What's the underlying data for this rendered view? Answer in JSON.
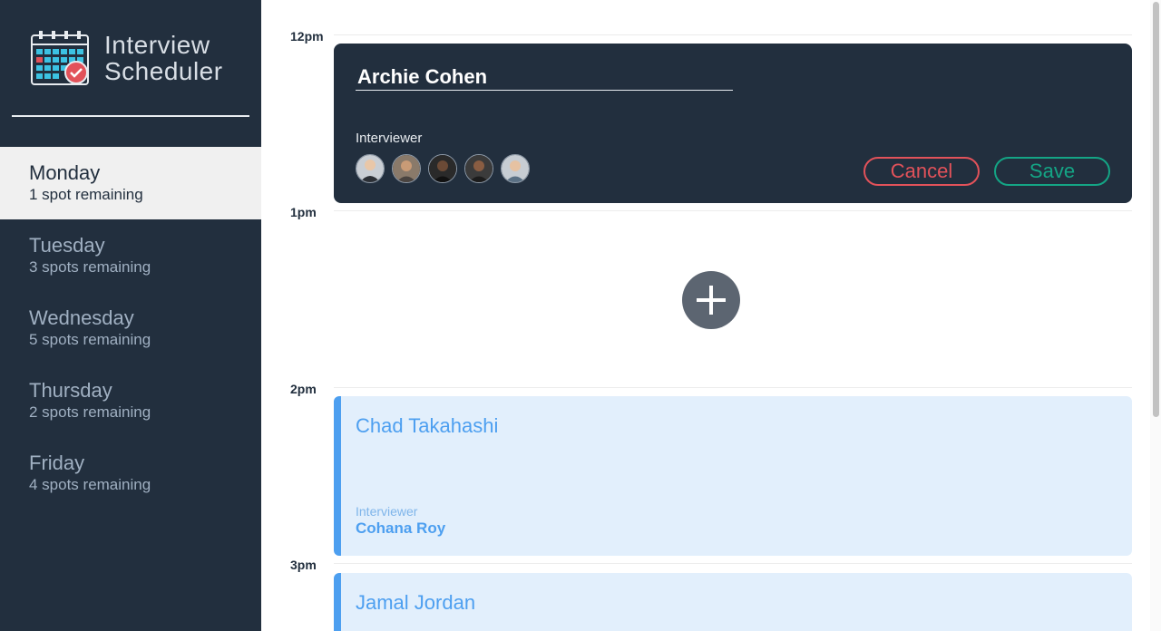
{
  "brand": {
    "line1": "Interview",
    "line2": "Scheduler",
    "logo_icon": "calendar-check-icon"
  },
  "days": [
    {
      "name": "Monday",
      "spots": "1 spot remaining",
      "selected": true
    },
    {
      "name": "Tuesday",
      "spots": "3 spots remaining",
      "selected": false
    },
    {
      "name": "Wednesday",
      "spots": "5 spots remaining",
      "selected": false
    },
    {
      "name": "Thursday",
      "spots": "2 spots remaining",
      "selected": false
    },
    {
      "name": "Friday",
      "spots": "4 spots remaining",
      "selected": false
    }
  ],
  "times": [
    "12pm",
    "1pm",
    "2pm",
    "3pm"
  ],
  "form": {
    "student_name": "Archie Cohen",
    "interviewer_label": "Interviewer",
    "interviewer_avatars": [
      "avatar-1",
      "avatar-2",
      "avatar-3",
      "avatar-4",
      "avatar-5"
    ],
    "cancel_label": "Cancel",
    "save_label": "Save"
  },
  "add_icon": "plus-icon",
  "appointments": [
    {
      "student": "Chad Takahashi",
      "interviewer_label": "Interviewer",
      "interviewer": "Cohana Roy"
    },
    {
      "student": "Jamal Jordan"
    }
  ],
  "colors": {
    "sidebar_bg": "#222f3e",
    "accent_blue": "#4d9ff0",
    "cancel_red": "#e2525a",
    "save_green": "#14a585"
  }
}
